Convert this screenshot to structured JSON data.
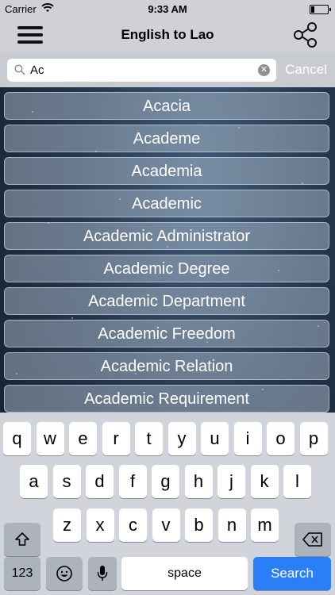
{
  "status_bar": {
    "carrier": "Carrier",
    "time": "9:33 AM",
    "battery_level": 0.2
  },
  "nav": {
    "title": "English to Lao",
    "menu_icon": "hamburger-menu-icon",
    "share_icon": "share-icon"
  },
  "search": {
    "value": "Ac",
    "placeholder": "",
    "cancel_label": "Cancel"
  },
  "results": [
    "Acacia",
    "Academe",
    "Academia",
    "Academic",
    "Academic Administrator",
    "Academic Degree",
    "Academic Department",
    "Academic Freedom",
    "Academic Relation",
    "Academic Requirement"
  ],
  "keyboard": {
    "row1": [
      "q",
      "w",
      "e",
      "r",
      "t",
      "y",
      "u",
      "i",
      "o",
      "p"
    ],
    "row2": [
      "a",
      "s",
      "d",
      "f",
      "g",
      "h",
      "j",
      "k",
      "l"
    ],
    "row3": [
      "z",
      "x",
      "c",
      "v",
      "b",
      "n",
      "m"
    ],
    "numbers_label": "123",
    "space_label": "space",
    "search_label": "Search",
    "shift_icon": "shift-icon",
    "delete_icon": "backspace-icon",
    "emoji_icon": "emoji-icon",
    "mic_icon": "microphone-icon"
  },
  "colors": {
    "accent_blue": "#2a7ef6",
    "bar_gray": "#cfd1d6"
  }
}
